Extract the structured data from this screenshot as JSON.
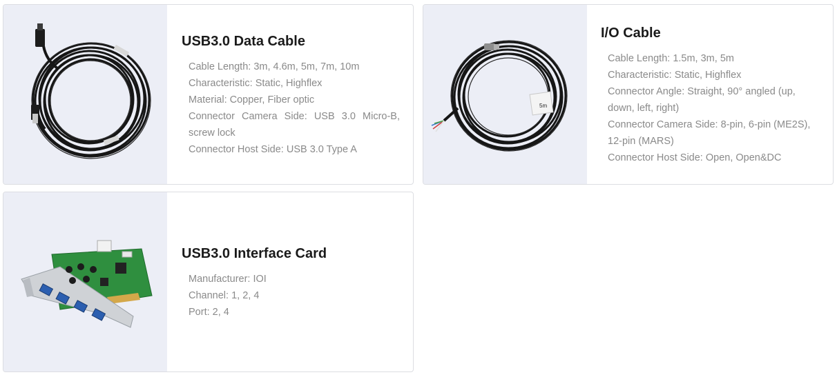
{
  "products": [
    {
      "title": "USB3.0 Data Cable",
      "image": "usb-data-cable-image",
      "specs": [
        "Cable Length: 3m, 4.6m, 5m, 7m, 10m",
        "Characteristic: Static, Highflex",
        "Material: Copper, Fiber optic",
        "Connector Camera Side: USB 3.0 Micro-B, screw lock",
        "Connector Host Side: USB 3.0 Type A"
      ]
    },
    {
      "title": "I/O Cable",
      "image": "io-cable-image",
      "specs": [
        "Cable Length: 1.5m, 3m, 5m",
        "Characteristic: Static, Highflex",
        "Connector Angle: Straight, 90° angled (up, down, left, right)",
        "Connector Camera Side: 8-pin, 6-pin (ME2S), 12-pin (MARS)",
        "Connector Host Side: Open, Open&DC"
      ],
      "cable_tag": "5m"
    },
    {
      "title": "USB3.0 Interface Card",
      "image": "usb-interface-card-image",
      "specs": [
        "Manufacturer: IOI",
        "Channel: 1, 2, 4",
        "Port: 2, 4"
      ]
    }
  ],
  "colors": {
    "card_border": "#dcdde2",
    "image_panel": "#eceef6",
    "title": "#1a1a1a",
    "spec_text": "#8a8a8a",
    "pcb_green": "#2f8f3f"
  }
}
